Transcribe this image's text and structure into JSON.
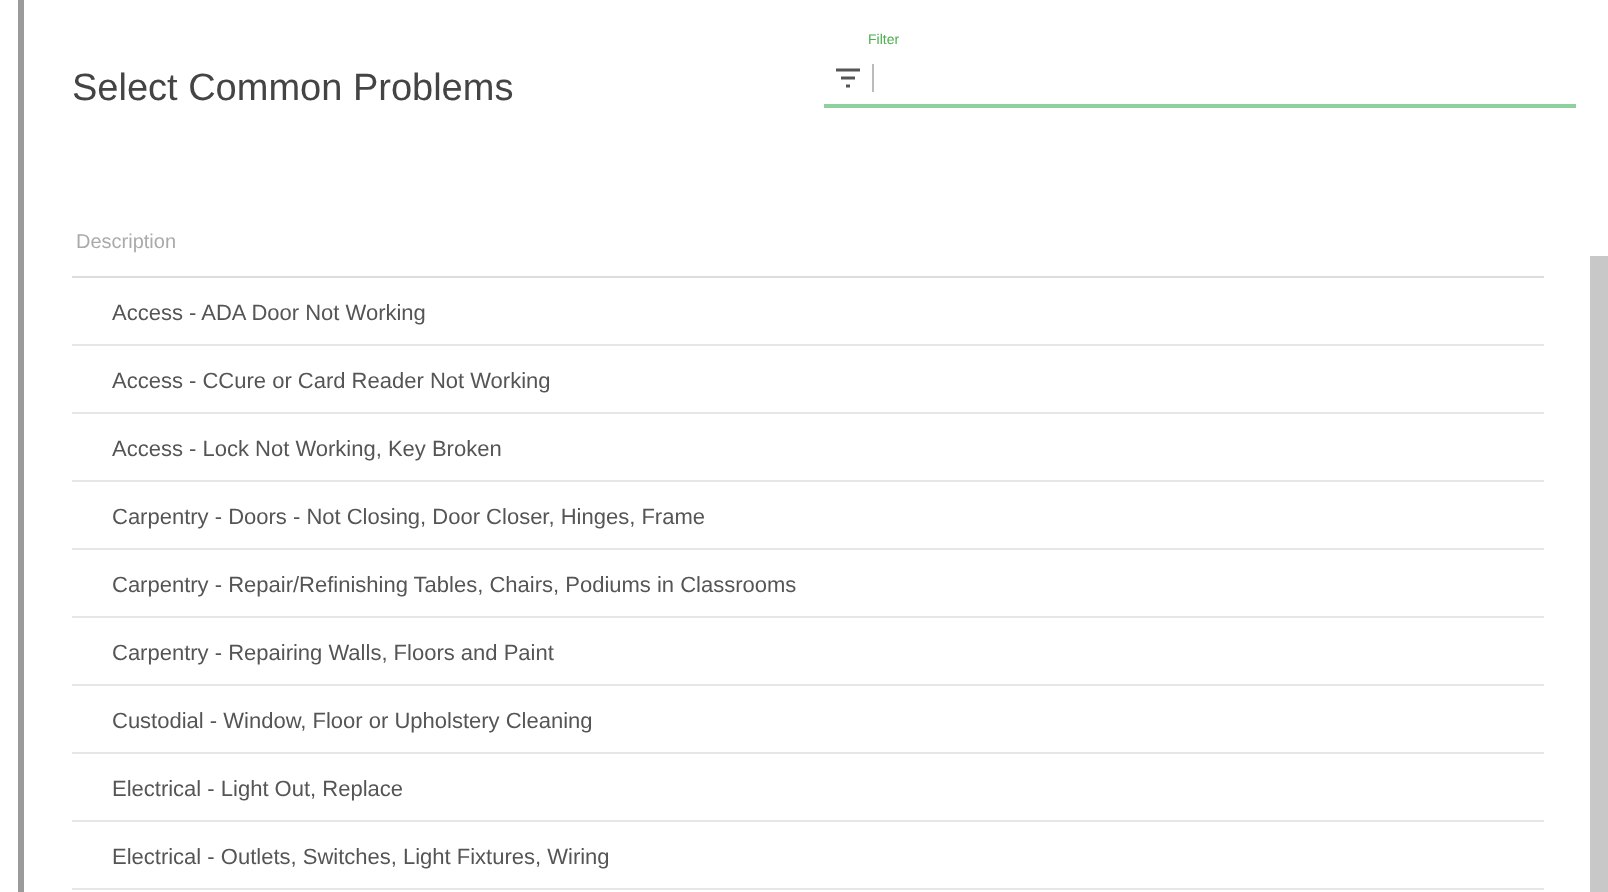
{
  "title": "Select Common Problems",
  "filter": {
    "label": "Filter"
  },
  "table": {
    "columns": [
      "Description"
    ],
    "rows": [
      {
        "description": "Access - ADA Door Not Working"
      },
      {
        "description": "Access - CCure or Card Reader Not Working"
      },
      {
        "description": "Access - Lock Not Working, Key Broken"
      },
      {
        "description": "Carpentry - Doors - Not Closing, Door Closer, Hinges, Frame"
      },
      {
        "description": "Carpentry - Repair/Refinishing Tables, Chairs, Podiums in Classrooms"
      },
      {
        "description": "Carpentry - Repairing Walls, Floors and Paint"
      },
      {
        "description": "Custodial - Window, Floor or Upholstery Cleaning"
      },
      {
        "description": "Electrical - Light Out, Replace"
      },
      {
        "description": "Electrical - Outlets, Switches, Light Fixtures, Wiring"
      }
    ]
  }
}
